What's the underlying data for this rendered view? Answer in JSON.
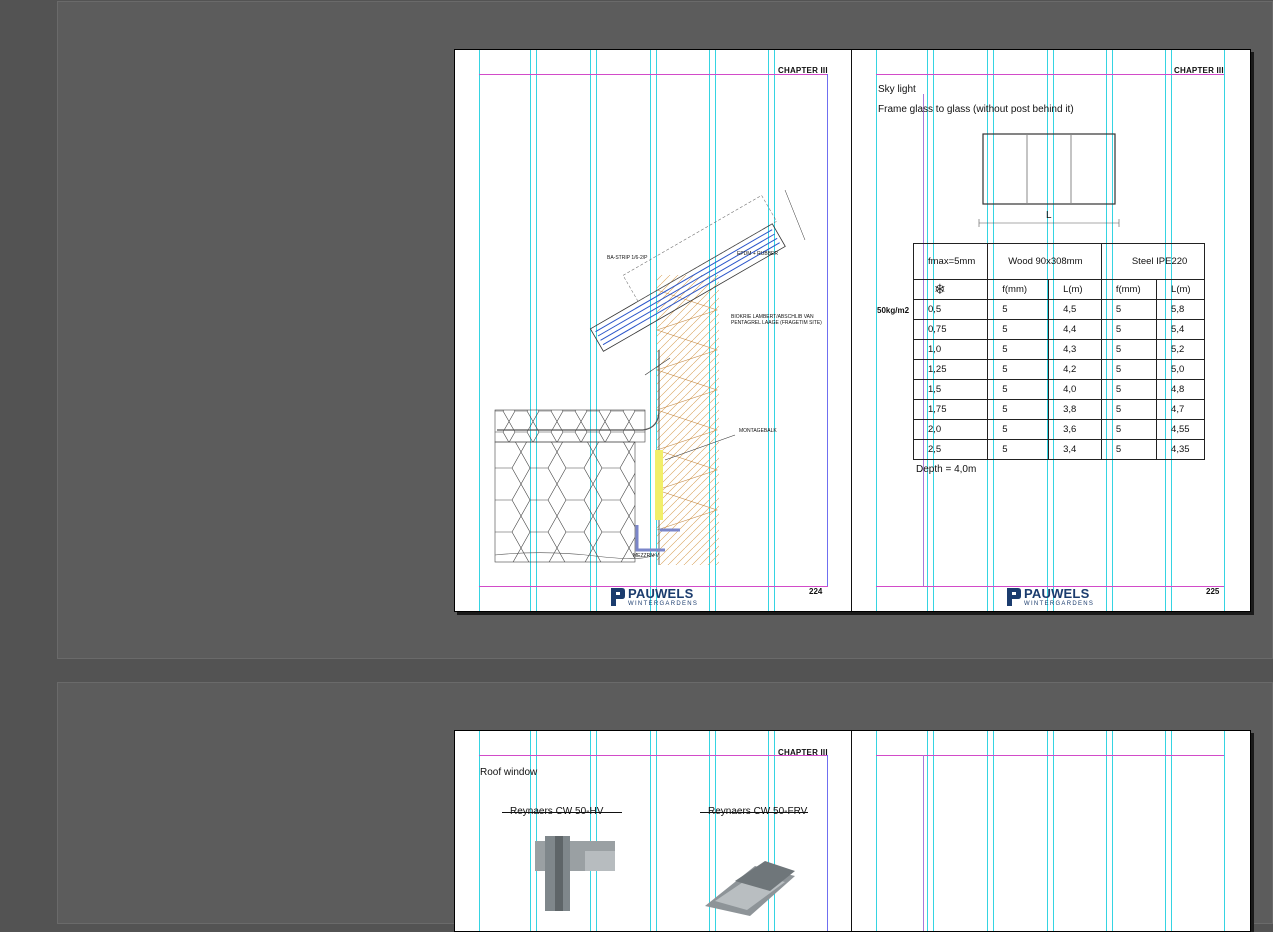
{
  "spread1": {
    "left_page": {
      "chapter": "CHAPTER III",
      "page_number": "224",
      "drawing_labels": {
        "top_left": "BA-STRIP 1/6-2/P",
        "top_right": "EPDM + RUBBER",
        "right_1": "BIOKRIE LAMBERT/ABSCHLIB VAN",
        "right_2": "PENTAGREL LAAGE (FRAGETIM SITE)",
        "mid_right": "MONTAGEBALK",
        "bottom": "MEZZRN-V"
      },
      "logo": {
        "name": "PAUWELS",
        "sub": "WINTERGARDENS"
      }
    },
    "right_page": {
      "chapter": "CHAPTER III",
      "page_number": "225",
      "heading": "Sky light",
      "subheading": "Frame glass to glass (without post behind it)",
      "dimension_label": "L",
      "load_label": "50kg/m2",
      "depth_note": "Depth = 4,0m",
      "table": {
        "header1": [
          "fmax=5mm",
          "Wood 90x308mm",
          "Steel IPE220"
        ],
        "header2": [
          "❄",
          "f(mm)",
          "L(m)",
          "f(mm)",
          "L(m)"
        ],
        "rows": [
          [
            "0,5",
            "5",
            "4,5",
            "5",
            "5,8"
          ],
          [
            "0,75",
            "5",
            "4,4",
            "5",
            "5,4"
          ],
          [
            "1,0",
            "5",
            "4,3",
            "5",
            "5,2"
          ],
          [
            "1,25",
            "5",
            "4,2",
            "5",
            "5,0"
          ],
          [
            "1,5",
            "5",
            "4,0",
            "5",
            "4,8"
          ],
          [
            "1,75",
            "5",
            "3,8",
            "5",
            "4,7"
          ],
          [
            "2,0",
            "5",
            "3,6",
            "5",
            "4,55"
          ],
          [
            "2,5",
            "5",
            "3,4",
            "5",
            "4,35"
          ]
        ]
      },
      "logo": {
        "name": "PAUWELS",
        "sub": "WINTERGARDENS"
      }
    }
  },
  "spread2": {
    "left_page": {
      "chapter": "CHAPTER III",
      "heading": "Roof window",
      "product_left": "Reynaers CW 50-HV",
      "product_right": "Reynaers CW 50-FRV"
    }
  },
  "colors": {
    "guide": "#35d4e2",
    "margin": "#d24bc9",
    "column_margin": "#6f6ff0",
    "pasteboard": "#5c5c5c",
    "brand": "#1b3c6e"
  }
}
